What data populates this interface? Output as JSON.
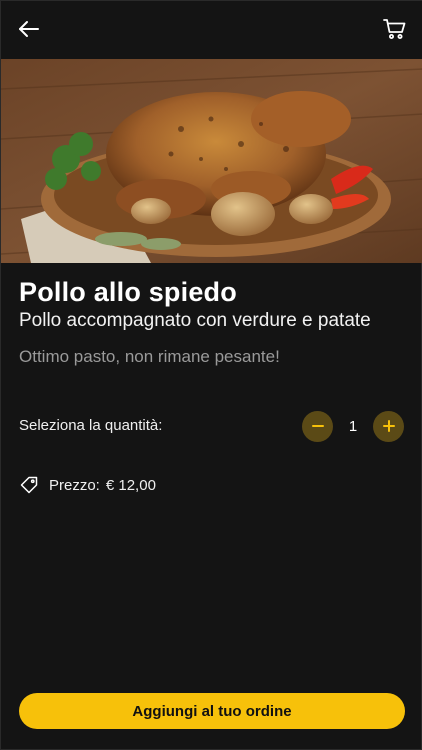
{
  "header": {
    "back_icon": "arrow-left-icon",
    "cart_icon": "shopping-cart-icon"
  },
  "product": {
    "name": "Pollo allo spiedo",
    "subtitle": "Pollo accompagnato con verdure e patate",
    "description": "Ottimo pasto, non rimane pesante!",
    "image_icon": "roast-chicken-photo"
  },
  "quantity": {
    "label": "Seleziona la quantità:",
    "value": "1",
    "decrement_icon": "minus-icon",
    "increment_icon": "plus-icon"
  },
  "price": {
    "icon": "price-tag-icon",
    "label": "Prezzo:",
    "value": "€ 12,00"
  },
  "cta": {
    "label": "Aggiungi al tuo ordine"
  },
  "colors": {
    "background": "#141414",
    "accent": "#f7c10a",
    "stepper_bg": "#5b4a16"
  }
}
